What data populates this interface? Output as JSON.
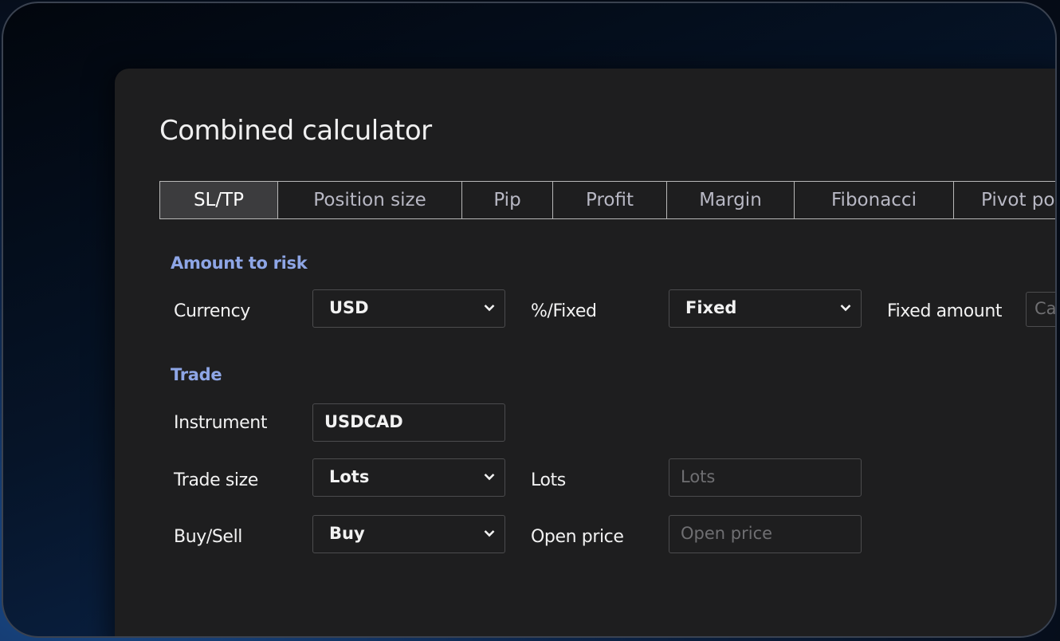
{
  "title": "Combined calculator",
  "tabs": [
    "SL/TP",
    "Position size",
    "Pip",
    "Profit",
    "Margin",
    "Fibonacci",
    "Pivot po"
  ],
  "active_tab": "SL/TP",
  "amount_to_risk": {
    "heading": "Amount to risk",
    "currency_label": "Currency",
    "currency_value": "USD",
    "mode_label": "%/Fixed",
    "mode_value": "Fixed",
    "fixed_amount_label": "Fixed amount",
    "fixed_amount_placeholder": "Ca"
  },
  "trade": {
    "heading": "Trade",
    "instrument_label": "Instrument",
    "instrument_value": "USDCAD",
    "trade_size_label": "Trade size",
    "trade_size_value": "Lots",
    "lots_label": "Lots",
    "lots_placeholder": "Lots",
    "buy_sell_label": "Buy/Sell",
    "buy_sell_value": "Buy",
    "open_price_label": "Open price",
    "open_price_placeholder": "Open price"
  },
  "colors": {
    "panel": "#1e1e1f",
    "section_heading": "#8ea6e6",
    "active_tab": "#3c3c3e"
  }
}
